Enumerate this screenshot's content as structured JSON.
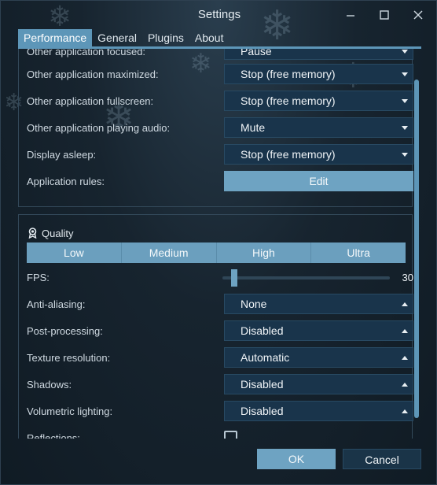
{
  "window": {
    "title": "Settings"
  },
  "tabs": [
    {
      "label": "Performance",
      "active": true
    },
    {
      "label": "General",
      "active": false
    },
    {
      "label": "Plugins",
      "active": false
    },
    {
      "label": "About",
      "active": false
    }
  ],
  "performance": {
    "rows": [
      {
        "label": "Other application focused:",
        "value": "Pause"
      },
      {
        "label": "Other application maximized:",
        "value": "Stop (free memory)"
      },
      {
        "label": "Other application fullscreen:",
        "value": "Stop (free memory)"
      },
      {
        "label": "Other application playing audio:",
        "value": "Mute"
      },
      {
        "label": "Display asleep:",
        "value": "Stop (free memory)"
      }
    ],
    "app_rules": {
      "label": "Application rules:",
      "button": "Edit"
    }
  },
  "quality": {
    "title": "Quality",
    "presets": [
      "Low",
      "Medium",
      "High",
      "Ultra"
    ],
    "fps": {
      "label": "FPS:",
      "value": "30",
      "fraction": 0.07
    },
    "rows": [
      {
        "label": "Anti-aliasing:",
        "value": "None"
      },
      {
        "label": "Post-processing:",
        "value": "Disabled"
      },
      {
        "label": "Texture resolution:",
        "value": "Automatic"
      },
      {
        "label": "Shadows:",
        "value": "Disabled"
      },
      {
        "label": "Volumetric lighting:",
        "value": "Disabled"
      }
    ],
    "reflections": {
      "label": "Reflections:",
      "checked": false
    }
  },
  "footer": {
    "ok": "OK",
    "cancel": "Cancel"
  },
  "colors": {
    "accent": "#5d96b8",
    "button": "#6ea3c2",
    "dropdown": "#19344b"
  },
  "icons": {
    "minimize": "minimize-icon",
    "maximize": "maximize-icon",
    "close": "close-icon",
    "dropdown_down": "chevron-down-icon",
    "dropdown_up": "chevron-up-icon",
    "quality": "medal-icon"
  }
}
